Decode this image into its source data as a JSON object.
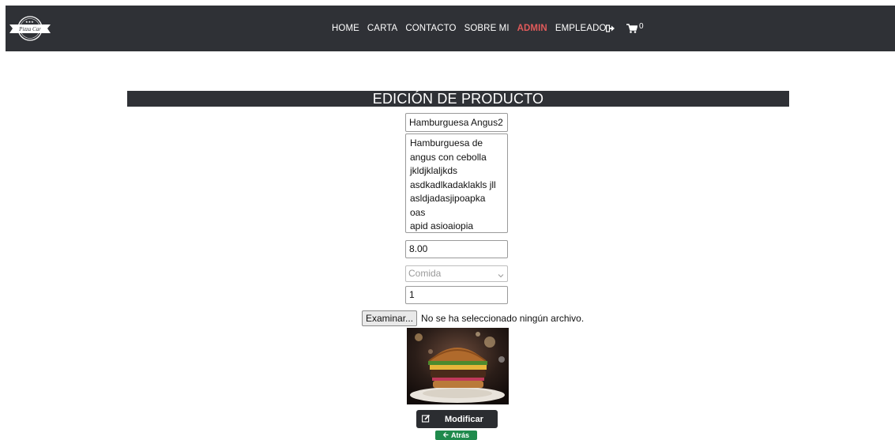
{
  "nav": {
    "logo_text": "Pizza Car",
    "links": [
      {
        "label": "HOME"
      },
      {
        "label": "CARTA"
      },
      {
        "label": "CONTACTO"
      },
      {
        "label": "SOBRE MI"
      },
      {
        "label": "ADMIN",
        "active": true
      },
      {
        "label": "EMPLEADO"
      }
    ],
    "cart_count": "0",
    "icons": [
      "logout-icon",
      "cart-icon"
    ],
    "active_color": "#e05a5a"
  },
  "page": {
    "title": "EDICIÓN DE PRODUCTO"
  },
  "form": {
    "name": "Hamburguesa Angus2",
    "description": "Hamburguesa de\nangus con cebolla\njkldjklaljkds\nasdkadlkadaklakls jll\nasldjadasjipoapka  oas\napid asioaiopia\ndasdia`dia`da",
    "price": "8.00",
    "category_placeholder": "Comida",
    "quantity": "1",
    "file_button": "Examinar...",
    "file_status": "No se ha seleccionado ningún archivo."
  },
  "actions": {
    "modify_label": "Modificar",
    "back_label": "Atrás"
  },
  "colors": {
    "navbar": "#2f3136",
    "back_button": "#1f8a4c",
    "modify_button": "#2b2d31"
  }
}
